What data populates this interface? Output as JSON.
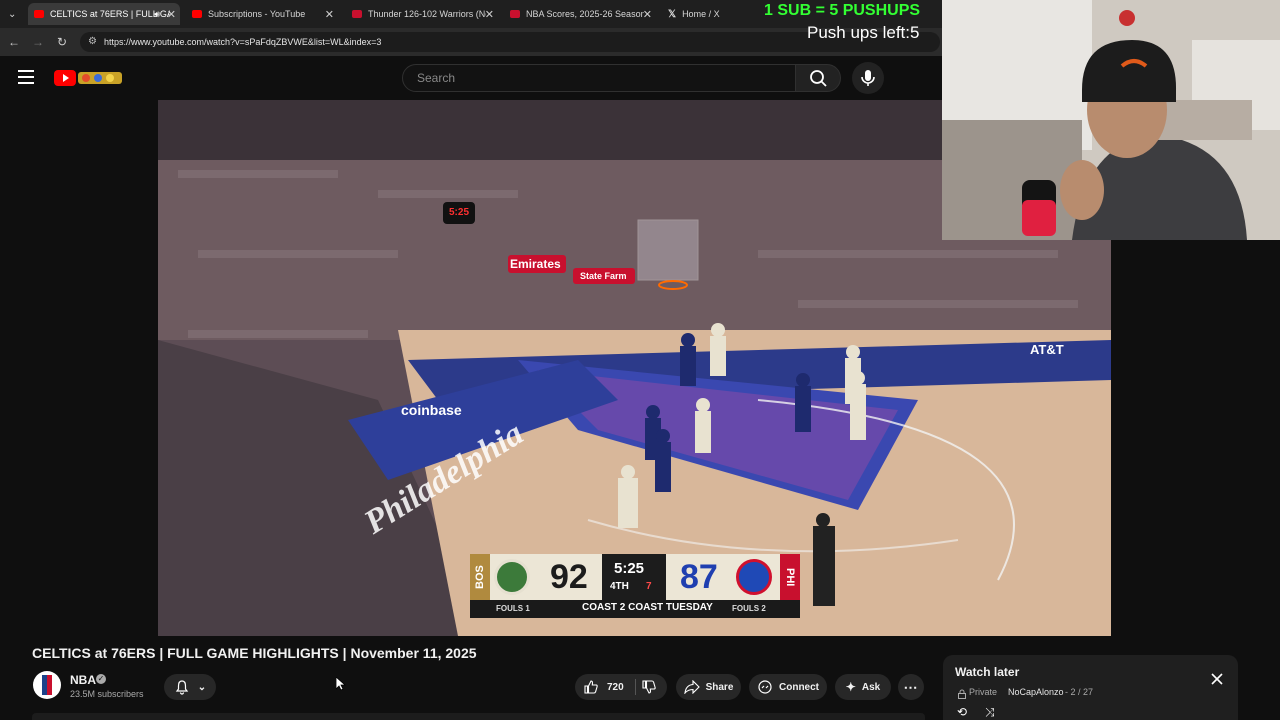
{
  "tabs": [
    {
      "label": "CELTICS at 76ERS | FULL GA",
      "color": "#ff0000",
      "active": true
    },
    {
      "label": "Subscriptions - YouTube",
      "color": "#ff0000",
      "active": false
    },
    {
      "label": "Thunder 126-102 Warriors (No",
      "color": "#d00000",
      "active": false
    },
    {
      "label": "NBA Scores, 2025-26 Season -",
      "color": "#d00000",
      "active": false
    },
    {
      "label": "Home / X",
      "color": "#ffffff",
      "active": false
    }
  ],
  "url": "https://www.youtube.com/watch?v=sPaFdqZBVWE&list=WL&index=3",
  "search": {
    "placeholder": "Search"
  },
  "overlay": {
    "sub_pushups": "1 SUB = 5 PUSHUPS",
    "pushups_left": "Push ups left:5"
  },
  "scoreboard": {
    "away_abbr": "BOS",
    "away_score": "92",
    "clock": "5:25",
    "period": "4TH",
    "shot_clock": "7",
    "home_score": "87",
    "home_abbr": "PHI",
    "away_fouls": "FOULS 1",
    "home_fouls": "FOULS 2",
    "footer": "COAST 2 COAST TUESDAY"
  },
  "court_text": {
    "emirates": "Emirates",
    "statefarm": "State Farm",
    "coinbase": "coinbase",
    "philly": "Philadelphia",
    "att": "AT&T"
  },
  "video": {
    "title": "CELTICS at 76ERS | FULL GAME HIGHLIGHTS | November 11, 2025"
  },
  "channel": {
    "name": "NBA",
    "subscribers": "23.5M subscribers"
  },
  "actions": {
    "likes": "720",
    "share": "Share",
    "connect": "Connect",
    "ask": "Ask"
  },
  "watch_later": {
    "title": "Watch later",
    "privacy": "Private",
    "owner": "NoCapAlonzo",
    "position": "- 2 / 27"
  }
}
